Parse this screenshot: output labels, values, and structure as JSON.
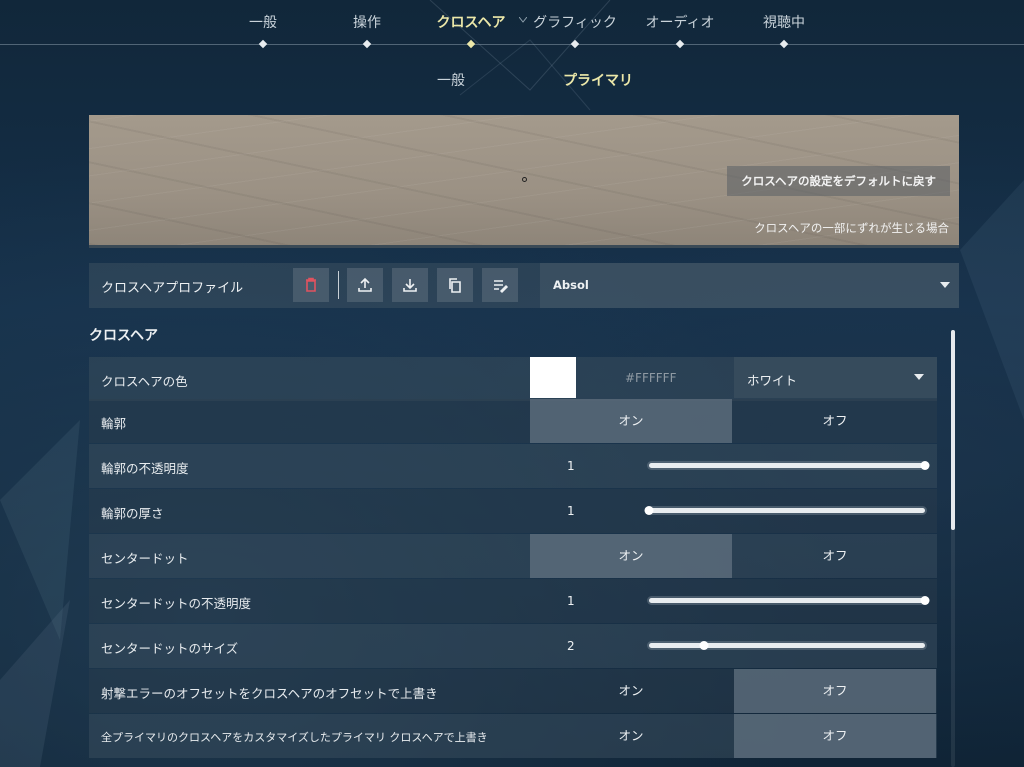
{
  "nav": {
    "tabs": [
      {
        "label": "一般"
      },
      {
        "label": "操作"
      },
      {
        "label": "クロスヘア"
      },
      {
        "label": "グラフィック"
      },
      {
        "label": "オーディオ"
      },
      {
        "label": "視聴中"
      }
    ],
    "active_tab": "クロスヘア"
  },
  "subnav": {
    "tabs": [
      {
        "label": "一般"
      },
      {
        "label": "プライマリ"
      }
    ],
    "active_tab": "プライマリ"
  },
  "preview": {
    "reset_label": "クロスヘアの設定をデフォルトに戻す",
    "note": "クロスヘアの一部にずれが生じる場合"
  },
  "profile": {
    "label": "クロスヘアプロファイル",
    "buttons": [
      "trash-icon",
      "upload-icon",
      "download-icon",
      "copy-icon",
      "rename-icon"
    ],
    "selected": "Absol"
  },
  "section": {
    "title": "クロスヘア"
  },
  "rows": {
    "color": {
      "label": "クロスヘアの色",
      "hex": "#FFFFFF",
      "swatch": "#FFFFFF",
      "selected": "ホワイト"
    },
    "outline": {
      "label": "輪郭",
      "on": "オン",
      "off": "オフ",
      "value": "オン"
    },
    "outline_opacity": {
      "label": "輪郭の不透明度",
      "value": "1",
      "fraction": 1.0
    },
    "outline_thickness": {
      "label": "輪郭の厚さ",
      "value": "1",
      "fraction": 0.0
    },
    "center_dot": {
      "label": "センタードット",
      "on": "オン",
      "off": "オフ",
      "value": "オン"
    },
    "center_dot_opacity": {
      "label": "センタードットの不透明度",
      "value": "1",
      "fraction": 1.0
    },
    "center_dot_size": {
      "label": "センタードットのサイズ",
      "value": "2",
      "fraction": 0.2
    },
    "firing_error": {
      "label": "射撃エラーのオフセットをクロスヘアのオフセットで上書き",
      "on": "オン",
      "off": "オフ",
      "value": "オフ"
    },
    "override_all": {
      "label": "全プライマリのクロスヘアをカスタマイズしたプライマリ クロスヘアで上書き",
      "on": "オン",
      "off": "オフ",
      "value": "オフ"
    }
  },
  "colors": {
    "accent": "#ECE8A9",
    "delete_icon": "#E0535F"
  }
}
